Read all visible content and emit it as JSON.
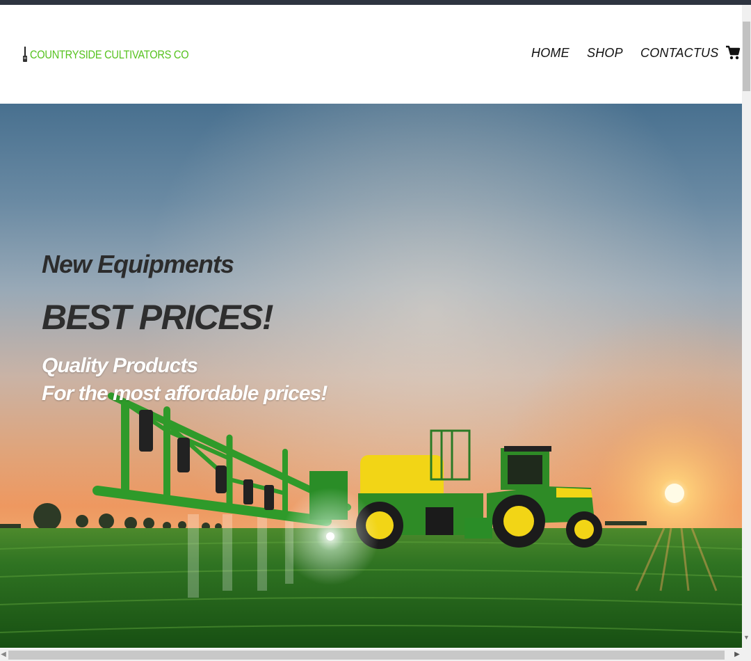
{
  "brand": {
    "name": "COUNTRYSIDE CULTIVATORS CO",
    "accent_color": "#56c21f"
  },
  "nav": {
    "items": [
      {
        "label": "HOME"
      },
      {
        "label": "SHOP"
      },
      {
        "label": "CONTACTUS"
      }
    ],
    "cart_icon": "shopping-cart-icon"
  },
  "hero": {
    "line1": "New Equipments",
    "line2": "BEST PRICES!",
    "line3": "Quality Products",
    "line4": "For the most affordable prices!",
    "image_subject": "green farm sprayer and tractor in a field at sunset"
  }
}
